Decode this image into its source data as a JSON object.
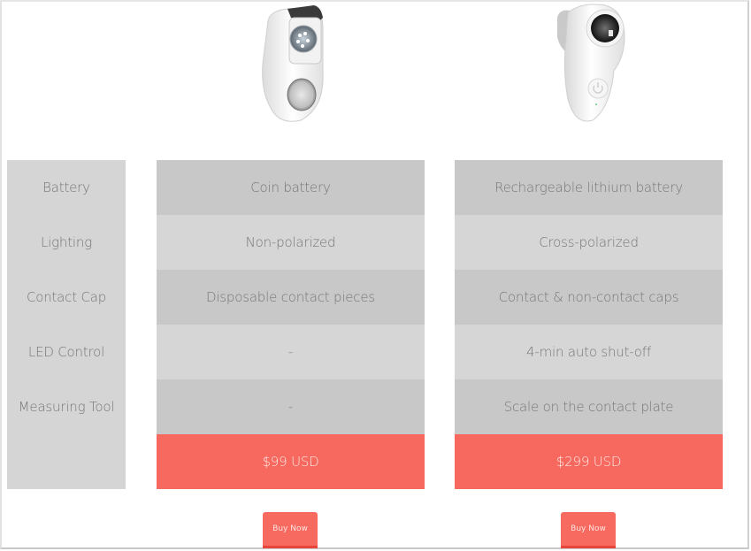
{
  "comparison": {
    "feature_labels": [
      "Battery",
      "Lighting",
      "Contact Cap",
      "LED Control",
      "Measuring Tool"
    ],
    "plans": [
      {
        "image": "dermatoscope-device-with-led-lens",
        "values": [
          "Coin battery",
          "Non-polarized",
          "Disposable contact pieces",
          "-",
          "-"
        ],
        "price": "$99 USD",
        "buy_label": "Buy Now"
      },
      {
        "image": "dermatoscope-device-with-camera-lens-and-power-button",
        "values": [
          "Rechargeable lithium battery",
          "Cross-polarized",
          "Contact & non-contact caps",
          "4-min auto shut-off",
          "Scale on the contact plate"
        ],
        "price": "$299 USD",
        "buy_label": "Buy Now"
      }
    ]
  },
  "colors": {
    "accent": "#f7685e",
    "row_dark": "#c8c8c8",
    "row_light": "#d6d6d6",
    "label_bg": "#d5d5d5",
    "text": "#777777"
  }
}
